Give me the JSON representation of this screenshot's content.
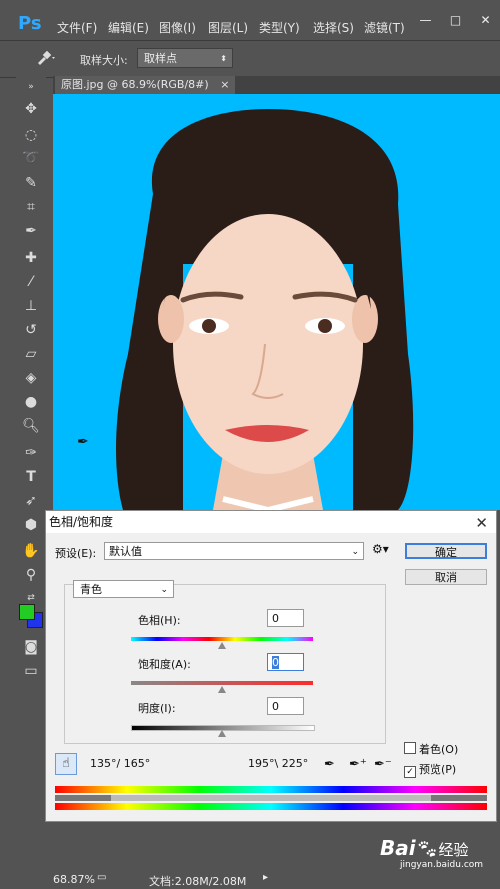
{
  "app": {
    "logo": "Ps",
    "menu": [
      "文件(F)",
      "编辑(E)",
      "图像(I)",
      "图层(L)",
      "类型(Y)",
      "选择(S)",
      "滤镜(T)"
    ],
    "window_buttons": [
      "—",
      "□",
      "✕"
    ]
  },
  "options_bar": {
    "sample_size_label": "取样大小:",
    "sample_size_value": "取样点"
  },
  "document": {
    "tab_title": "原图.jpg @ 68.9%(RGB/8#)",
    "tab_close": "×",
    "background_color": "#00baff"
  },
  "status_bar": {
    "zoom": "68.87%",
    "doc_size": "文档:2.08M/2.08M"
  },
  "dialog": {
    "title": "色相/饱和度",
    "close": "✕",
    "preset_label": "预设(E):",
    "preset_value": "默认值",
    "ok_button": "确定",
    "cancel_button": "取消",
    "channel_value": "青色",
    "hue_label": "色相(H):",
    "hue_value": "0",
    "saturation_label": "饱和度(A):",
    "saturation_value": "0",
    "lightness_label": "明度(I):",
    "lightness_value": "0",
    "colorize_label": "着色(O)",
    "colorize_checked": false,
    "preview_label": "预览(P)",
    "preview_checked": true,
    "angle_left": "135°/ 165°",
    "angle_right": "195°\\ 225°"
  },
  "watermark": {
    "brand": "Bai",
    "brand2": "经验",
    "url": "jingyan.baidu.com"
  },
  "colors": {
    "foreground": "#22cc22",
    "background": "#2233ee",
    "accent": "#3d7edb"
  }
}
